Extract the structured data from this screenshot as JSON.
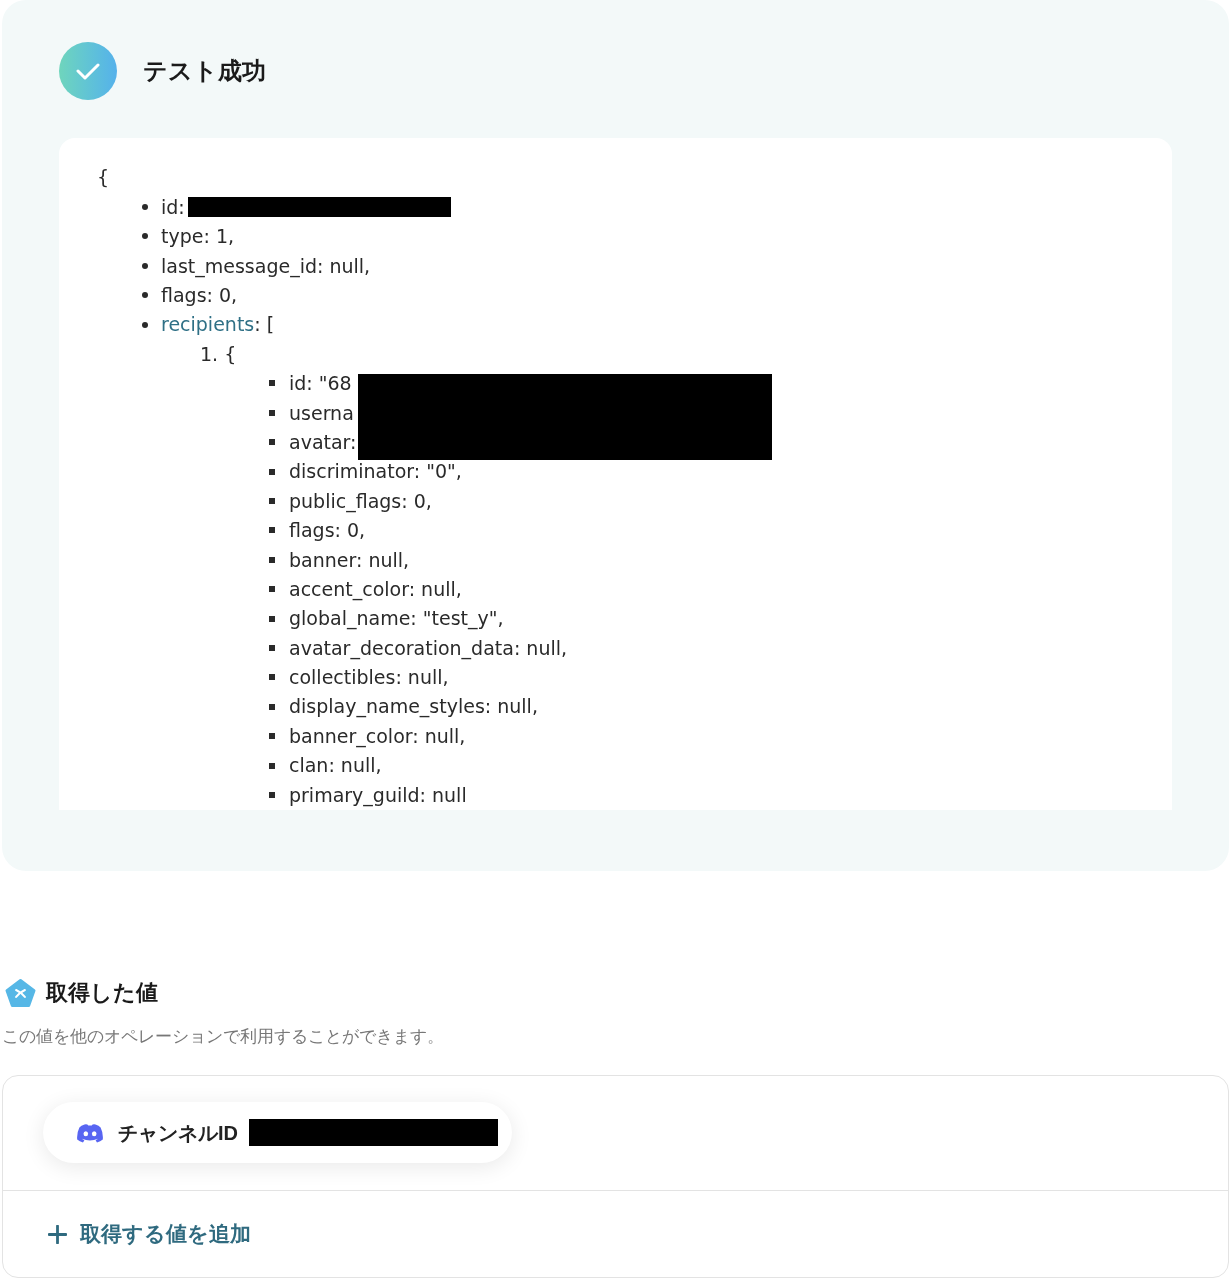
{
  "status": {
    "title": "テスト成功"
  },
  "response": {
    "open": "{",
    "fields": [
      {
        "kind": "line",
        "text": "id:",
        "redacted": true
      },
      {
        "kind": "line",
        "text": "type: 1,",
        "redacted": false
      },
      {
        "kind": "line",
        "text": "last_message_id: null,",
        "redacted": false
      },
      {
        "kind": "line",
        "text": "flags: 0,",
        "redacted": false
      },
      {
        "kind": "array",
        "key": "recipients",
        "text": ": [",
        "redacted": false,
        "items": [
          {
            "number": "1.",
            "open": "{",
            "fields": [
              {
                "kind": "line",
                "text": "id: \"68",
                "redacted": true
              },
              {
                "kind": "line",
                "text": "userna",
                "redacted": true
              },
              {
                "kind": "line",
                "text": "avatar:",
                "redacted": true
              },
              {
                "kind": "line",
                "text": "discriminator: \"0\",",
                "redacted": false
              },
              {
                "kind": "line",
                "text": "public_flags: 0,",
                "redacted": false
              },
              {
                "kind": "line",
                "text": "flags: 0,",
                "redacted": false
              },
              {
                "kind": "line",
                "text": "banner: null,",
                "redacted": false
              },
              {
                "kind": "line",
                "text": "accent_color: null,",
                "redacted": false
              },
              {
                "kind": "line",
                "text": "global_name: \"test_y\",",
                "redacted": false
              },
              {
                "kind": "line",
                "text": "avatar_decoration_data: null,",
                "redacted": false
              },
              {
                "kind": "line",
                "text": "collectibles: null,",
                "redacted": false
              },
              {
                "kind": "line",
                "text": "display_name_styles: null,",
                "redacted": false
              },
              {
                "kind": "line",
                "text": "banner_color: null,",
                "redacted": false
              },
              {
                "kind": "line",
                "text": "clan: null,",
                "redacted": false
              },
              {
                "kind": "line",
                "text": "primary_guild: null",
                "redacted": false
              }
            ]
          }
        ]
      }
    ]
  },
  "retrieved_values": {
    "title": "取得した値",
    "description": "この値を他のオペレーションで利用することができます。",
    "values": [
      {
        "label": "チャンネルID",
        "redacted": true
      }
    ],
    "add_button": {
      "label": "取得する値を追加"
    }
  }
}
